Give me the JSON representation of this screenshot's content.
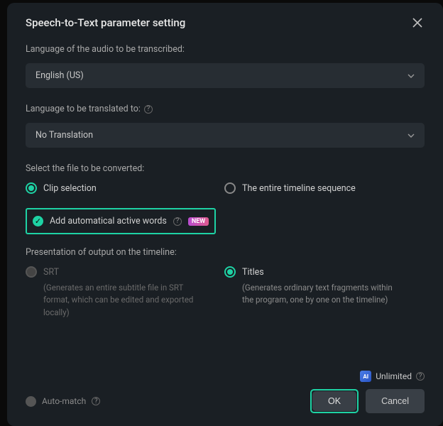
{
  "modal": {
    "title": "Speech-to-Text parameter setting"
  },
  "transcribe": {
    "label": "Language of the audio to be transcribed:",
    "value": "English (US)"
  },
  "translate": {
    "label": "Language to be translated to:",
    "value": "No Translation"
  },
  "file_select": {
    "label": "Select the file to be converted:",
    "clip": "Clip selection",
    "timeline": "The entire timeline sequence"
  },
  "active_words": {
    "label": "Add automatical active words",
    "badge": "NEW"
  },
  "presentation": {
    "label": "Presentation of output on the timeline:",
    "srt": {
      "title": "SRT",
      "desc": "(Generates an entire subtitle file in SRT format, which can be edited and exported locally)"
    },
    "titles": {
      "title": "Titles",
      "desc": "(Generates ordinary text fragments within the program, one by one on the timeline)"
    }
  },
  "unlimited": "Unlimited",
  "automatch": "Auto-match",
  "buttons": {
    "ok": "OK",
    "cancel": "Cancel"
  }
}
